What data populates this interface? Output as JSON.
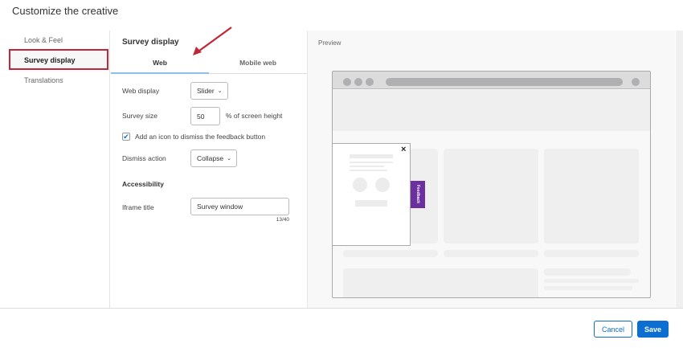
{
  "dialog": {
    "title": "Customize the creative"
  },
  "sidebar": {
    "items": [
      {
        "label": "Look & Feel"
      },
      {
        "label": "Survey display"
      },
      {
        "label": "Translations"
      }
    ]
  },
  "form": {
    "heading": "Survey display",
    "tabs": [
      {
        "label": "Web"
      },
      {
        "label": "Mobile web"
      }
    ],
    "web_display_label": "Web display",
    "web_display_value": "Slider",
    "survey_size_label": "Survey size",
    "survey_size_value": "50",
    "survey_size_unit": "% of screen height",
    "dismiss_icon_checkbox": "Add an icon to dismiss the feedback button",
    "dismiss_action_label": "Dismiss action",
    "dismiss_action_value": "Collapse",
    "accessibility_heading": "Accessibility",
    "iframe_title_label": "Iframe title",
    "iframe_title_value": "Survey window",
    "iframe_title_count": "13/40"
  },
  "preview": {
    "label": "Preview",
    "feedback_tab": "Feedback"
  },
  "footer": {
    "cancel": "Cancel",
    "save": "Save"
  },
  "colors": {
    "accent": "#0b6ed0",
    "feedback": "#6b2fa0",
    "highlight": "#c0283a"
  }
}
